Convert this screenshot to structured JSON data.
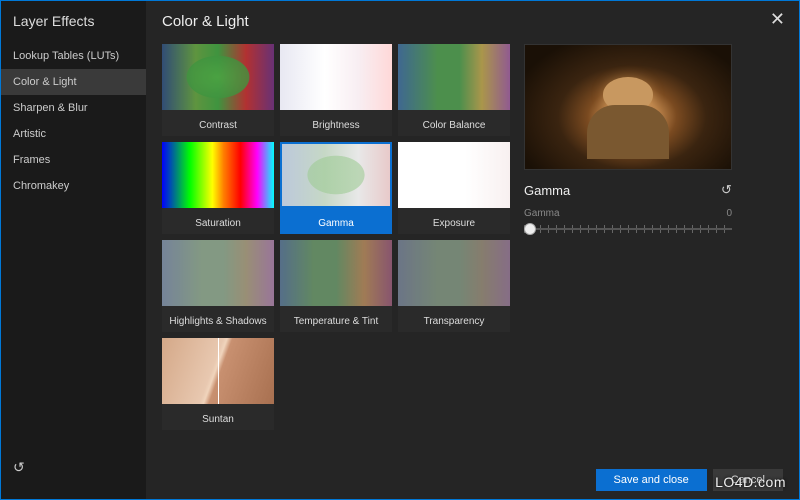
{
  "sidebar": {
    "title": "Layer Effects",
    "items": [
      {
        "label": "Lookup Tables (LUTs)",
        "selected": false
      },
      {
        "label": "Color & Light",
        "selected": true
      },
      {
        "label": "Sharpen & Blur",
        "selected": false
      },
      {
        "label": "Artistic",
        "selected": false
      },
      {
        "label": "Frames",
        "selected": false
      },
      {
        "label": "Chromakey",
        "selected": false
      }
    ]
  },
  "main": {
    "title": "Color & Light",
    "tiles": [
      {
        "label": "Contrast",
        "thumb": "grad-contrast"
      },
      {
        "label": "Brightness",
        "thumb": "grad-brightness"
      },
      {
        "label": "Color Balance",
        "thumb": "grad-colorbalance"
      },
      {
        "label": "Saturation",
        "thumb": "grad-saturation"
      },
      {
        "label": "Gamma",
        "thumb": "grad-gamma",
        "selected": true
      },
      {
        "label": "Exposure",
        "thumb": "grad-exposure"
      },
      {
        "label": "Highlights & Shadows",
        "thumb": "grad-highlights"
      },
      {
        "label": "Temperature & Tint",
        "thumb": "grad-temperature"
      },
      {
        "label": "Transparency",
        "thumb": "grad-transparency"
      },
      {
        "label": "Suntan",
        "thumb": "suntan"
      }
    ]
  },
  "preview": {
    "title": "Gamma",
    "slider_label": "Gamma",
    "slider_value": "0"
  },
  "buttons": {
    "save": "Save and close",
    "cancel": "Cancel"
  },
  "icons": {
    "close": "✕",
    "refresh": "↻"
  },
  "watermark": "LO4D.com"
}
